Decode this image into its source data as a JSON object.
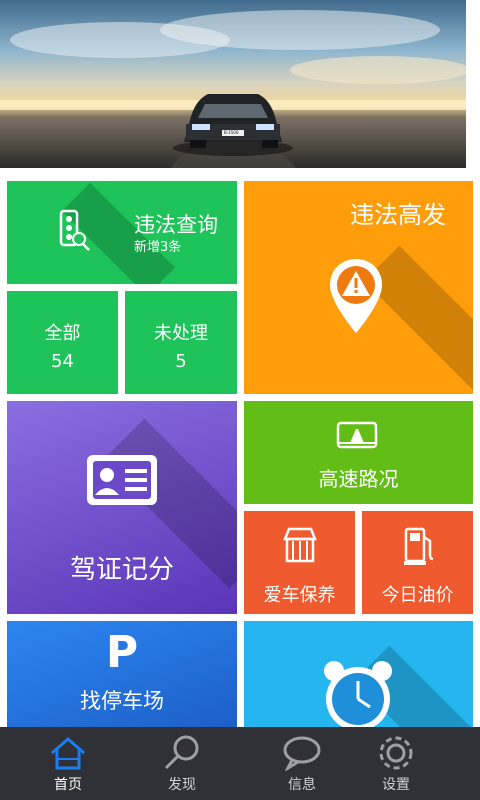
{
  "tiles": {
    "violation_query": {
      "title": "违法查询",
      "subtitle": "新增3条",
      "color": "#1ec35a"
    },
    "all": {
      "label": "全部",
      "count": "54"
    },
    "unprocessed": {
      "label": "未处理",
      "count": "5"
    },
    "hotspots": {
      "title": "违法高发",
      "color": "#ff9d0a"
    },
    "license_points": {
      "title": "驾证记分",
      "color": "#6b49c8"
    },
    "highway": {
      "title": "高速路况",
      "color": "#62bd17"
    },
    "car_care": {
      "title": "爱车保养",
      "color": "#ef5a2e"
    },
    "fuel_price": {
      "title": "今日油价",
      "color": "#ef5a2e"
    },
    "parking": {
      "title": "找停车场",
      "icon_letter": "P",
      "color": "#2478e8"
    },
    "alarm": {
      "color": "#25b6f0"
    }
  },
  "nav": {
    "items": [
      {
        "label": "首页",
        "icon": "home-icon",
        "active": true
      },
      {
        "label": "发现",
        "icon": "search-icon",
        "active": false
      },
      {
        "label": "信息",
        "icon": "chat-icon",
        "active": false
      },
      {
        "label": "设置",
        "icon": "gear-icon",
        "active": false
      }
    ],
    "active_color": "#1a7cf0"
  },
  "banner": {
    "plate_text": "B-1500"
  }
}
